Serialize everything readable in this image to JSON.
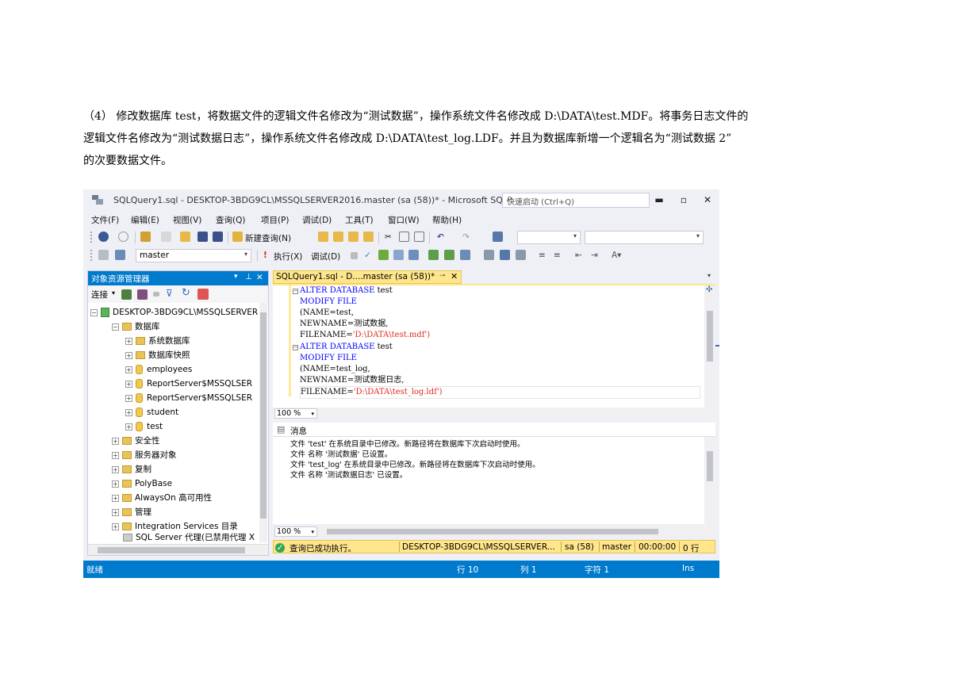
{
  "paragraph": {
    "line1": "（4） 修改数据库 test，将数据文件的逻辑文件名修改为“测试数据”，操作系统文件名修改成 D:\\DATA\\test.MDF。将事务日志文件的",
    "line2": "逻辑文件名修改为“测试数据日志”，操作系统文件名修改成 D:\\DATA\\test_log.LDF。并且为数据库新增一个逻辑名为“测试数据 2”",
    "line3": "的次要数据文件。"
  },
  "window": {
    "title": "SQLQuery1.sql - DESKTOP-3BDG9CL\\MSSQLSERVER2016.master (sa (58))* - Microsoft SQL...",
    "quick_launch_placeholder": "快速启动 (Ctrl+Q)"
  },
  "menu": [
    "文件(F)",
    "编辑(E)",
    "视图(V)",
    "查询(Q)",
    "项目(P)",
    "调试(D)",
    "工具(T)",
    "窗口(W)",
    "帮助(H)"
  ],
  "toolbar": {
    "new_query": "新建查询(N)",
    "database": "master",
    "execute": "执行(X)",
    "debug": "调试(D)"
  },
  "object_explorer": {
    "title": "对象资源管理器",
    "connect": "连接",
    "server": "DESKTOP-3BDG9CL\\MSSQLSERVER",
    "nodes": [
      "数据库",
      "系统数据库",
      "数据库快照",
      "employees",
      "ReportServer$MSSQLSER",
      "ReportServer$MSSQLSER",
      "student",
      "test",
      "安全性",
      "服务器对象",
      "复制",
      "PolyBase",
      "AlwaysOn 高可用性",
      "管理",
      "Integration Services 目录",
      "SQL Server 代理(已禁用代理 X"
    ]
  },
  "editor": {
    "tab": "SQLQuery1.sql - D....master (sa (58))*",
    "zoom": "100 %",
    "code": [
      {
        "kw": "ALTER DATABASE",
        "rest": " test",
        "str": ""
      },
      {
        "kw": "MODIFY FILE",
        "rest": "",
        "str": ""
      },
      {
        "kw": "",
        "rest": "(NAME=test,",
        "str": ""
      },
      {
        "kw": "",
        "rest": "NEWNAME=测试数据,",
        "str": ""
      },
      {
        "kw": "",
        "rest": "FILENAME=",
        "str": "'D:\\DATA\\test.mdf')"
      },
      {
        "kw": "ALTER DATABASE",
        "rest": " test",
        "str": ""
      },
      {
        "kw": "MODIFY FILE",
        "rest": "",
        "str": ""
      },
      {
        "kw": "",
        "rest": "(NAME=test_log,",
        "str": ""
      },
      {
        "kw": "",
        "rest": "NEWNAME=测试数据日志,",
        "str": ""
      },
      {
        "kw": "",
        "rest": "FILENAME=",
        "str": "'D:\\DATA\\test_log.ldf')"
      }
    ]
  },
  "messages": {
    "tab": "消息",
    "zoom": "100 %",
    "lines": [
      "文件 'test' 在系统目录中已修改。新路径将在数据库下次启动时使用。",
      "文件 名称 '测试数据' 已设置。",
      "文件 'test_log' 在系统目录中已修改。新路径将在数据库下次启动时使用。",
      "文件 名称 '测试数据日志' 已设置。"
    ]
  },
  "query_status": {
    "text": "查询已成功执行。",
    "server": "DESKTOP-3BDG9CL\\MSSQLSERVER...",
    "user": "sa (58)",
    "db": "master",
    "time": "00:00:00",
    "rows": "0 行"
  },
  "statusbar": {
    "ready": "就绪",
    "line": "行 10",
    "col": "列 1",
    "char": "字符 1",
    "mode": "Ins"
  },
  "colors": {
    "accent": "#007acc",
    "tab_yellow": "#ffe68c",
    "keyword": "#0000ff",
    "string": "#e0281c"
  }
}
